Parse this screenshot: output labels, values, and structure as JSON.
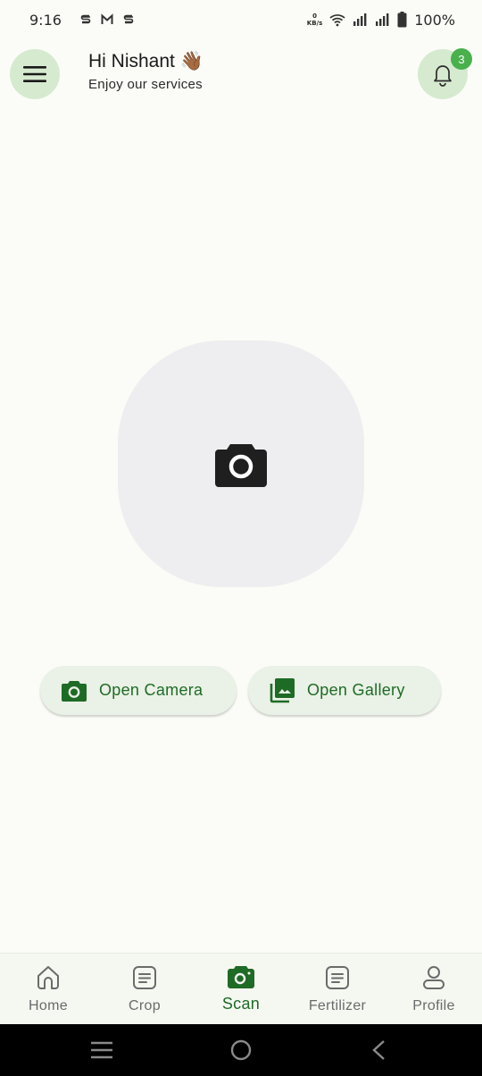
{
  "status_bar": {
    "time": "9:16",
    "net_speed_value": "0",
    "net_speed_unit": "KB/s",
    "battery": "100%"
  },
  "header": {
    "greeting": "Hi Nishant",
    "wave_emoji": "👋🏾",
    "subtitle": "Enjoy our services",
    "notification_count": "3"
  },
  "preview": {
    "icon": "camera-icon"
  },
  "actions": {
    "open_camera": "Open Camera",
    "open_gallery": "Open Gallery"
  },
  "bottom_nav": {
    "items": [
      {
        "label": "Home",
        "icon": "home-icon"
      },
      {
        "label": "Crop",
        "icon": "document-icon"
      },
      {
        "label": "Scan",
        "icon": "camera-icon"
      },
      {
        "label": "Fertilizer",
        "icon": "document-icon"
      },
      {
        "label": "Profile",
        "icon": "person-icon"
      }
    ],
    "active": "Scan"
  },
  "colors": {
    "accent": "#1e6b25",
    "pill_bg": "#d6ead0",
    "badge": "#49b04c",
    "background": "#fbfcf7"
  }
}
